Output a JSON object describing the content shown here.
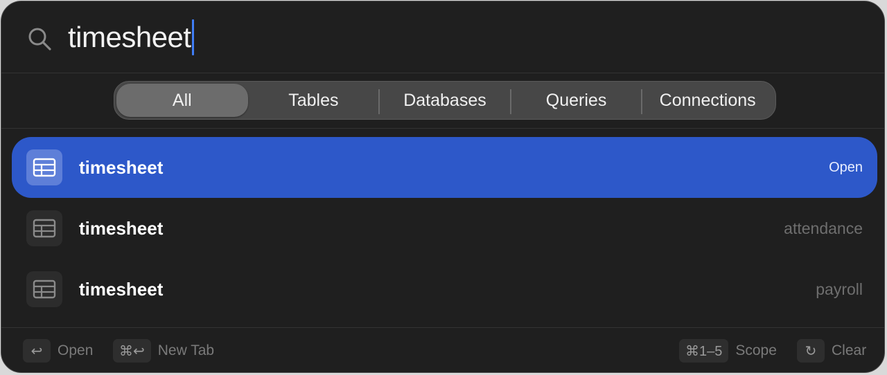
{
  "search": {
    "value": "timesheet"
  },
  "scope_tabs": [
    {
      "label": "All",
      "active": true
    },
    {
      "label": "Tables",
      "active": false
    },
    {
      "label": "Databases",
      "active": false
    },
    {
      "label": "Queries",
      "active": false
    },
    {
      "label": "Connections",
      "active": false
    }
  ],
  "results": [
    {
      "title": "timesheet",
      "meta": "Open",
      "icon": "table-icon",
      "selected": true
    },
    {
      "title": "timesheet",
      "meta": "attendance",
      "icon": "table-icon",
      "selected": false
    },
    {
      "title": "timesheet",
      "meta": "payroll",
      "icon": "table-icon",
      "selected": false
    }
  ],
  "footer": {
    "open": {
      "key": "↩",
      "label": "Open"
    },
    "new_tab": {
      "key": "⌘↩",
      "label": "New Tab"
    },
    "scope": {
      "key": "⌘1–5",
      "label": "Scope"
    },
    "clear": {
      "key": "↻",
      "label": "Clear"
    }
  },
  "colors": {
    "accent": "#2d58c9",
    "caret": "#3f7df6",
    "background": "#1f1f1f"
  }
}
